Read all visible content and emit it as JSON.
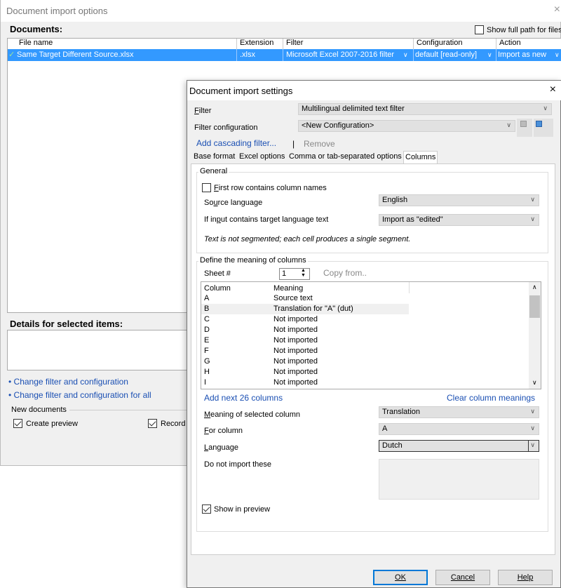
{
  "back_window": {
    "title": "Document import options",
    "close_glyph": "×",
    "documents_heading": "Documents:",
    "show_full_path_label": "Show full path for files",
    "columns": [
      "File name",
      "Extension",
      "Filter",
      "Configuration",
      "Action"
    ],
    "row": {
      "check_glyph": "✓",
      "file_name": "Same Target Different Source.xlsx",
      "extension": ".xlsx",
      "filter": "Microsoft Excel 2007-2016 filter",
      "configuration": "default [read-only]",
      "action": "Import as new"
    },
    "details_heading": "Details for selected items:",
    "link_change_filter": "• Change filter and configuration",
    "link_change_filter_all": "• Change filter and configuration for all",
    "new_documents_label": "New documents",
    "create_preview_label": "Create preview",
    "record_label": "Record v"
  },
  "dialog": {
    "title": "Document import settings",
    "close_glyph": "×",
    "filter_label": "Filter",
    "filter_value": "Multilingual delimited text filter",
    "filter_config_label": "Filter configuration",
    "filter_config_value": "<New Configuration>",
    "add_cascading": "Add cascading filter...",
    "separator": "|",
    "remove": "Remove",
    "tabs": [
      "Base format",
      "Excel options",
      "Comma or tab-separated options",
      "Columns"
    ],
    "general_label": "General",
    "first_row_label": "First row contains column names",
    "source_language_label": "Source language",
    "source_language_value": "English",
    "target_text_label": "If input contains target language text",
    "target_text_value": "Import as \"edited\"",
    "note": "Text is not segmented; each cell produces a single segment.",
    "define_label": "Define the meaning of columns",
    "sheet_label": "Sheet #",
    "sheet_value": "1",
    "copy_from": "Copy from..",
    "col_header_column": "Column",
    "col_header_meaning": "Meaning",
    "columns_list": [
      {
        "col": "A",
        "meaning": "Source text"
      },
      {
        "col": "B",
        "meaning": "Translation for \"A\" (dut)"
      },
      {
        "col": "C",
        "meaning": "Not imported"
      },
      {
        "col": "D",
        "meaning": "Not imported"
      },
      {
        "col": "E",
        "meaning": "Not imported"
      },
      {
        "col": "F",
        "meaning": "Not imported"
      },
      {
        "col": "G",
        "meaning": "Not imported"
      },
      {
        "col": "H",
        "meaning": "Not imported"
      },
      {
        "col": "I",
        "meaning": "Not imported"
      }
    ],
    "add_next": "Add next 26 columns",
    "clear_meanings": "Clear column meanings",
    "meaning_label": "Meaning of selected column",
    "meaning_value": "Translation",
    "for_column_label": "For column",
    "for_column_value": "A",
    "language_label": "Language",
    "language_value": "Dutch",
    "do_not_import_label": "Do not import these",
    "show_in_preview_label": "Show in preview",
    "ok": "OK",
    "cancel": "Cancel",
    "help": "Help"
  }
}
